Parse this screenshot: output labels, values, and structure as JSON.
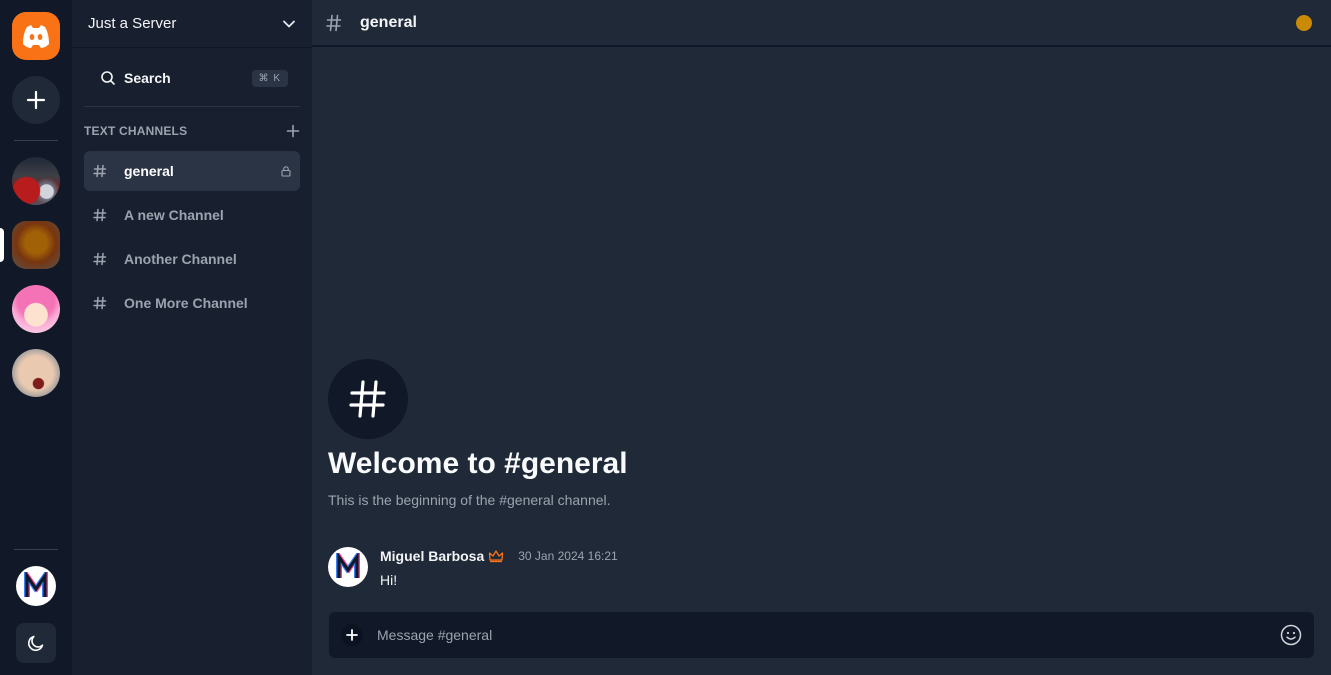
{
  "app": {
    "brand_color": "#f97316",
    "status_color": "#ca8a04"
  },
  "rail": {
    "logo_icon": "discord-like-logo-icon",
    "add_server_icon": "plus-icon",
    "servers": [
      {
        "name": "server-car",
        "active": false
      },
      {
        "name": "server-hamster",
        "active": true
      },
      {
        "name": "server-anime",
        "active": false
      },
      {
        "name": "server-kid",
        "active": false
      }
    ],
    "theme_toggle_icon": "moon-icon"
  },
  "sidebar": {
    "server_name": "Just a Server",
    "search_label": "Search",
    "search_shortcut": "⌘ K",
    "section_title": "TEXT CHANNELS",
    "channels": [
      {
        "label": "general",
        "active": true,
        "locked": true
      },
      {
        "label": "A new Channel",
        "active": false
      },
      {
        "label": "Another Channel",
        "active": false
      },
      {
        "label": "One More Channel",
        "active": false
      }
    ]
  },
  "main": {
    "channel_title": "general",
    "welcome_title": "Welcome to #general",
    "welcome_subtitle": "This is the beginning of the #general channel.",
    "messages": [
      {
        "author": "Miguel Barbosa",
        "time": "30 Jan 2024 16:21",
        "text": "Hi!",
        "role_icon": "crown-icon"
      }
    ],
    "composer_placeholder": "Message #general"
  }
}
